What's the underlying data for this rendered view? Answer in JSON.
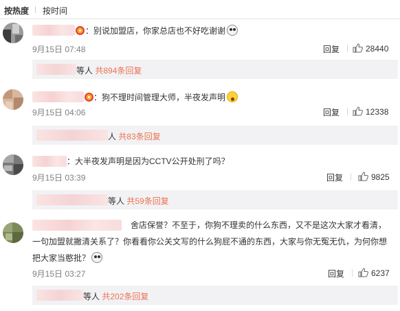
{
  "sort": {
    "hot": "按热度",
    "time": "按时间"
  },
  "comments": [
    {
      "text": "：别说加盟店，你家总店也不好吃谢谢",
      "time": "9月15日 07:48",
      "reply_label": "回复",
      "likes": "28440",
      "sub_people": "等人",
      "sub_count": "共894条回复"
    },
    {
      "text": "：狗不理时间管理大师，半夜发声明",
      "time": "9月15日 04:06",
      "reply_label": "回复",
      "likes": "12338",
      "sub_people": "人",
      "sub_count": "共83条回复"
    },
    {
      "text": "：大半夜发声明是因为CCTV公开处刑了吗？",
      "time": "9月15日 03:39",
      "reply_label": "回复",
      "likes": "9825",
      "sub_people": "等人",
      "sub_count": "共59条回复"
    },
    {
      "line1": "舍店保誉？不至于，你狗不理卖的什么东西，又不是这次大家才看清，",
      "line2": "一句加盟就撇清关系了？你看看你公关文写的什么狗屁不通的东西，大家与你无冤无仇，为何你想",
      "line3": "把大家当憨批？",
      "time": "9月15日 03:27",
      "reply_label": "回复",
      "likes": "6237",
      "sub_people": "等人",
      "sub_count": "共202条回复"
    }
  ],
  "icons": {
    "like": "thumbs-up-icon",
    "badge": "member-badge-icon",
    "emoji_1": "ghost-emoji-icon",
    "emoji_2": "scream-emoji-icon"
  },
  "colors": {
    "count_link": "#eb7350",
    "sub_bg": "#f2f2f5",
    "time": "#808080"
  }
}
